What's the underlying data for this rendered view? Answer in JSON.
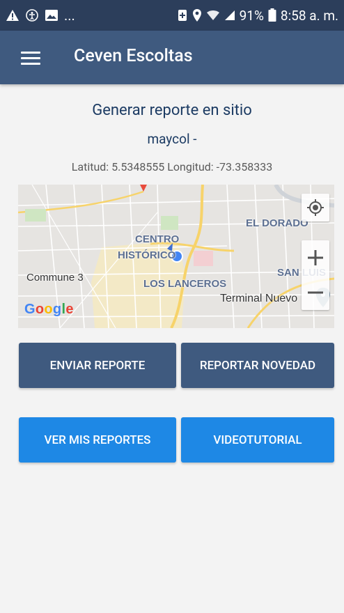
{
  "status_bar": {
    "battery_percent": "91%",
    "time": "8:58 a. m.",
    "notification_overflow": "...",
    "icons": [
      "warning-icon",
      "accessibility-icon",
      "image-icon",
      "battery-saver-icon",
      "location-pin-icon",
      "wifi-icon",
      "signal-icon",
      "battery-icon"
    ]
  },
  "app_bar": {
    "title": "Ceven Escoltas",
    "menu_icon": "hamburger-menu-icon"
  },
  "main": {
    "title": "Generar reporte en sitio",
    "user": "maycol -",
    "coordinates": "Latitud: 5.5348555 Longitud: -73.358333"
  },
  "map": {
    "labels": {
      "el_dorado": "EL DORADO",
      "centro": "CENTRO",
      "historico": "HISTÓRICO",
      "commune": "Commune 3",
      "los_lanceros": "LOS LANCEROS",
      "san_luis": "SAN LUIS",
      "terminal": "Terminal Nuevo"
    },
    "provider": "Google",
    "controls": [
      "my-location-icon",
      "zoom-in-icon",
      "zoom-out-icon"
    ]
  },
  "buttons": {
    "enviar_reporte": "ENVIAR REPORTE",
    "reportar_novedad": "REPORTAR NOVEDAD",
    "ver_mis_reportes": "VER MIS REPORTES",
    "videotutorial": "VIDEOTUTORIAL"
  },
  "colors": {
    "status_bar": "#2c3e5b",
    "app_bar": "#3f5a7f",
    "primary_button": "#3f5a7f",
    "secondary_button": "#1e88e5",
    "heading_text": "#1c3b63"
  }
}
